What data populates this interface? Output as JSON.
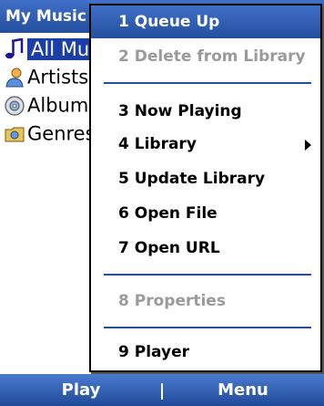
{
  "title": "My Music",
  "library": [
    {
      "label": "All Music",
      "icon": "music-note-icon",
      "selected": true
    },
    {
      "label": "Artists",
      "icon": "artist-icon",
      "selected": false
    },
    {
      "label": "Albums",
      "icon": "album-disc-icon",
      "selected": false
    },
    {
      "label": "Genres",
      "icon": "genre-folder-icon",
      "selected": false
    }
  ],
  "menu": {
    "items": [
      {
        "label": "1 Queue Up",
        "state": "highlighted"
      },
      {
        "label": "2 Delete from Library",
        "state": "disabled"
      },
      {
        "label": "3 Now Playing",
        "state": "enabled"
      },
      {
        "label": "4 Library",
        "state": "enabled",
        "submenu": true
      },
      {
        "label": "5 Update Library",
        "state": "enabled"
      },
      {
        "label": "6 Open File",
        "state": "enabled"
      },
      {
        "label": "7 Open URL",
        "state": "enabled"
      },
      {
        "label": "8 Properties",
        "state": "disabled"
      },
      {
        "label": "9 Player",
        "state": "enabled"
      }
    ]
  },
  "softkeys": {
    "left": "Play",
    "right": "Menu"
  },
  "colors": {
    "accent": "#244f9e",
    "highlight_text": "#ffffff",
    "disabled_text": "#9a9a9a"
  }
}
